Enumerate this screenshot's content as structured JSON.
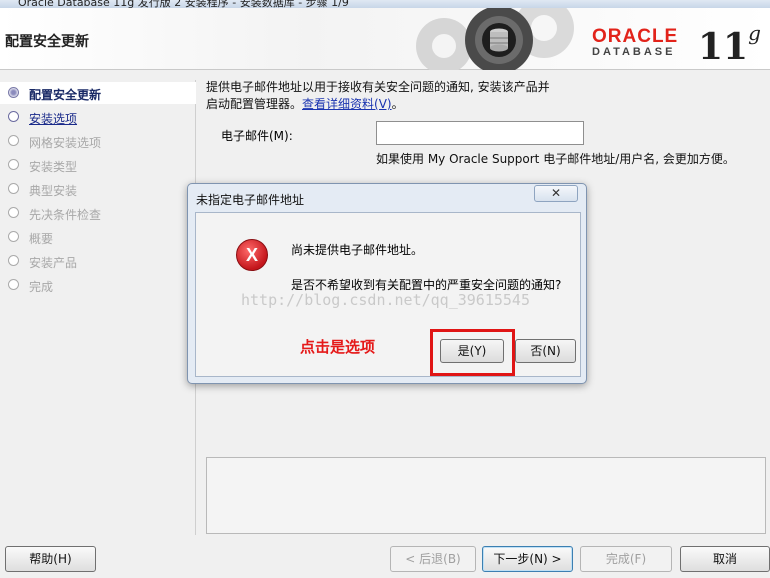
{
  "window": {
    "title": "Oracle Database 11g 发行版 2 安装程序 - 安装数据库 - 步骤 1/9"
  },
  "header": {
    "page_title": "配置安全更新",
    "brand_top": "ORACLE",
    "brand_bottom": "DATABASE",
    "version": "11",
    "version_sup": "g"
  },
  "steps": [
    {
      "label": "配置安全更新",
      "state": "current"
    },
    {
      "label": "安装选项",
      "state": "next"
    },
    {
      "label": "网格安装选项",
      "state": "pending"
    },
    {
      "label": "安装类型",
      "state": "pending"
    },
    {
      "label": "典型安装",
      "state": "pending"
    },
    {
      "label": "先决条件检查",
      "state": "pending"
    },
    {
      "label": "概要",
      "state": "pending"
    },
    {
      "label": "安装产品",
      "state": "pending"
    },
    {
      "label": "完成",
      "state": "pending"
    }
  ],
  "main": {
    "desc_line1": "提供电子邮件地址以用于接收有关安全问题的通知, 安装该产品并",
    "desc_line2_prefix": "启动配置管理器。",
    "desc_link": "查看详细资料(V)",
    "desc_line2_suffix": "。",
    "email_label": "电子邮件(M):",
    "email_value": "",
    "email_hint": "如果使用 My Oracle Support 电子邮件地址/用户名, 会更加方便。"
  },
  "dialog": {
    "title": "未指定电子邮件地址",
    "close": "✕",
    "icon": "error-icon",
    "message1": "尚未提供电子邮件地址。",
    "message2": "是否不希望收到有关配置中的严重安全问题的通知?",
    "yes_label": "是(Y)",
    "no_label": "否(N)",
    "annotation": "点击是选项",
    "watermark": "http://blog.csdn.net/qq_39615545"
  },
  "footer": {
    "help": "帮助(H)",
    "back": "< 后退(B)",
    "next": "下一步(N) >",
    "finish": "完成(F)",
    "cancel": "取消"
  },
  "colors": {
    "accent_red": "#e2231a",
    "link": "#1a34b0",
    "highlight": "#e01515"
  }
}
